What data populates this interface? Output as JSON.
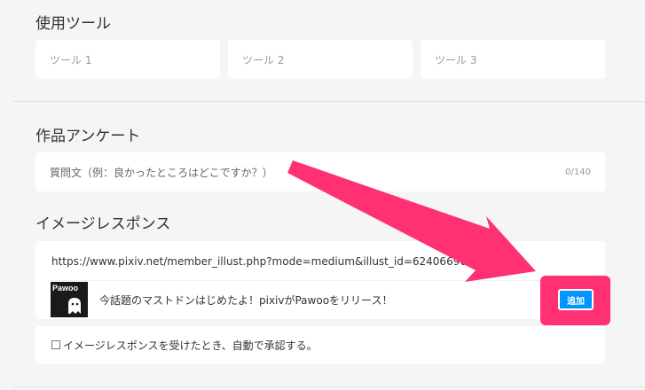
{
  "tools": {
    "title": "使用ツール",
    "placeholders": [
      "ツール 1",
      "ツール 2",
      "ツール 3"
    ]
  },
  "survey": {
    "title": "作品アンケート",
    "question_placeholder": "質問文（例：良かったところはどこですか？）",
    "counter": "0/140"
  },
  "image_response": {
    "title": "イメージレスポンス",
    "url": "https://www.pixiv.net/member_illust.php?mode=medium&illust_id=62406690",
    "preview": {
      "thumbnail_label": "Pawoo",
      "text": "今話題のマストドンはじめたよ！pixivがPawooをリリース！"
    },
    "add_button": "追加",
    "auto_approve": "イメージレスポンスを受けたとき、自動で承認する。"
  },
  "colors": {
    "highlight": "#ff3173",
    "button": "#0096fa",
    "background": "#f5f5f5"
  }
}
